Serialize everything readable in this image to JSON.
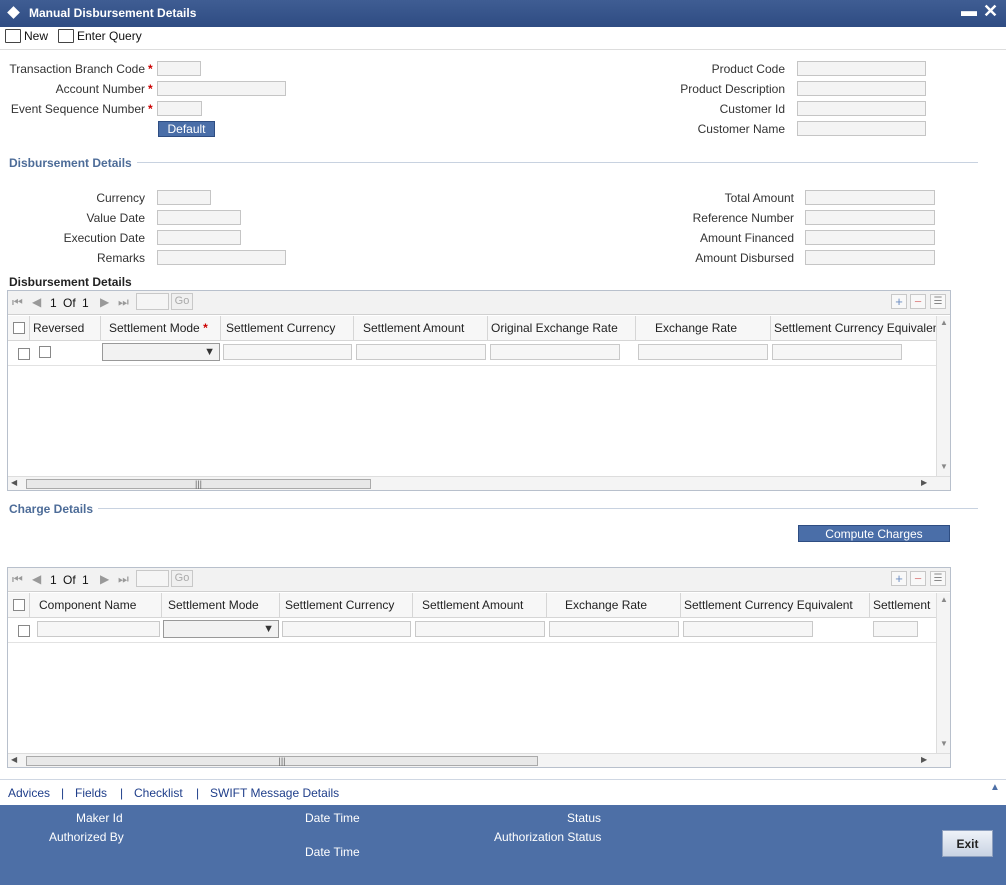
{
  "window": {
    "title": "Manual Disbursement Details"
  },
  "toolbar": {
    "new_label": "New",
    "enter_query_label": "Enter Query"
  },
  "header_fields": {
    "branch_code": "Transaction Branch Code",
    "account_number": "Account Number",
    "event_seq": "Event Sequence Number",
    "default_button": "Default",
    "product_code": "Product Code",
    "product_desc": "Product Description",
    "customer_id": "Customer Id",
    "customer_name": "Customer Name",
    "required_mark": "*"
  },
  "disbursement": {
    "section_title": "Disbursement Details",
    "currency": "Currency",
    "value_date": "Value Date",
    "execution_date": "Execution Date",
    "remarks": "Remarks",
    "total_amount": "Total Amount",
    "reference_number": "Reference Number",
    "amount_financed": "Amount Financed",
    "amount_disbursed": "Amount Disbursed",
    "grid_title": "Disbursement Details",
    "grid": {
      "page_current": "1",
      "page_of": "Of",
      "page_total": "1",
      "go": "Go",
      "columns": [
        "Reversed",
        "Settlement Mode",
        "Settlement Currency",
        "Settlement Amount",
        "Original Exchange Rate",
        "Exchange Rate",
        "Settlement Currency Equivalent"
      ]
    }
  },
  "charges": {
    "section_title": "Charge Details",
    "compute_button": "Compute Charges",
    "grid": {
      "page_current": "1",
      "page_of": "Of",
      "page_total": "1",
      "go": "Go",
      "columns": [
        "Component Name",
        "Settlement Mode",
        "Settlement Currency",
        "Settlement Amount",
        "Exchange Rate",
        "Settlement Currency Equivalent",
        "Settlement"
      ]
    }
  },
  "links": [
    "Advices",
    "Fields",
    "Checklist",
    "SWIFT Message Details"
  ],
  "link_separator": "|",
  "footer": {
    "maker_id": "Maker Id",
    "authorized_by": "Authorized By",
    "date_time_1": "Date Time",
    "date_time_2": "Date Time",
    "status": "Status",
    "auth_status": "Authorization Status",
    "exit": "Exit"
  },
  "colors": {
    "title_bar": "#2f4c83",
    "footer": "#4d6fa6",
    "section_text": "#4d6c98",
    "required": "#cc0000"
  }
}
